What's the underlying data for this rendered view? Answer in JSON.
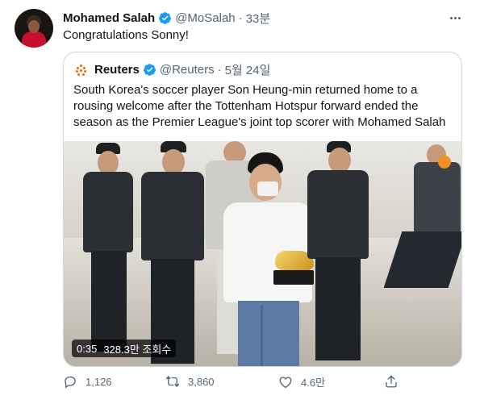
{
  "tweet": {
    "author_name": "Mohamed Salah",
    "author_handle": "@MoSalah",
    "separator": "·",
    "time": "33분",
    "text": "Congratulations Sonny!"
  },
  "quoted": {
    "author_name": "Reuters",
    "author_handle": "@Reuters",
    "separator": "·",
    "time": "5월 24일",
    "text": "South Korea's soccer player Son Heung-min returned home to a rousing welcome after the Tottenham Hotspur forward ended the season as the Premier League's joint top scorer with Mohamed Salah"
  },
  "video": {
    "duration": "0:35",
    "views": "328.3만 조회수"
  },
  "actions": {
    "reply_count": "1,126",
    "retweet_count": "3,860",
    "like_count": "4.6만"
  },
  "colors": {
    "verified": "#1d9bf0",
    "secondary_text": "#536471",
    "reuters_orange": "#fa6400"
  },
  "icons": [
    "verified-badge-icon",
    "more-icon",
    "reply-icon",
    "retweet-icon",
    "like-icon",
    "share-icon"
  ]
}
